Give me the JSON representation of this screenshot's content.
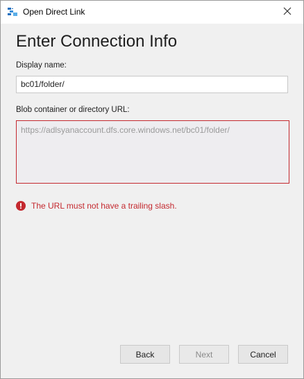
{
  "window": {
    "title": "Open Direct Link",
    "icon": "storage-explorer-icon",
    "close_icon": "close-icon"
  },
  "page": {
    "heading": "Enter Connection Info"
  },
  "form": {
    "display_name_label": "Display name:",
    "display_name_value": "bc01/folder/",
    "url_label": "Blob container or directory URL:",
    "url_value": "https://adlsyanaccount.dfs.core.windows.net/bc01/folder/"
  },
  "error": {
    "icon": "error-icon",
    "message": "The URL must not have a trailing slash.",
    "color": "#c4292f"
  },
  "buttons": {
    "back_label": "Back",
    "next_label": "Next",
    "next_enabled": false,
    "cancel_label": "Cancel"
  }
}
